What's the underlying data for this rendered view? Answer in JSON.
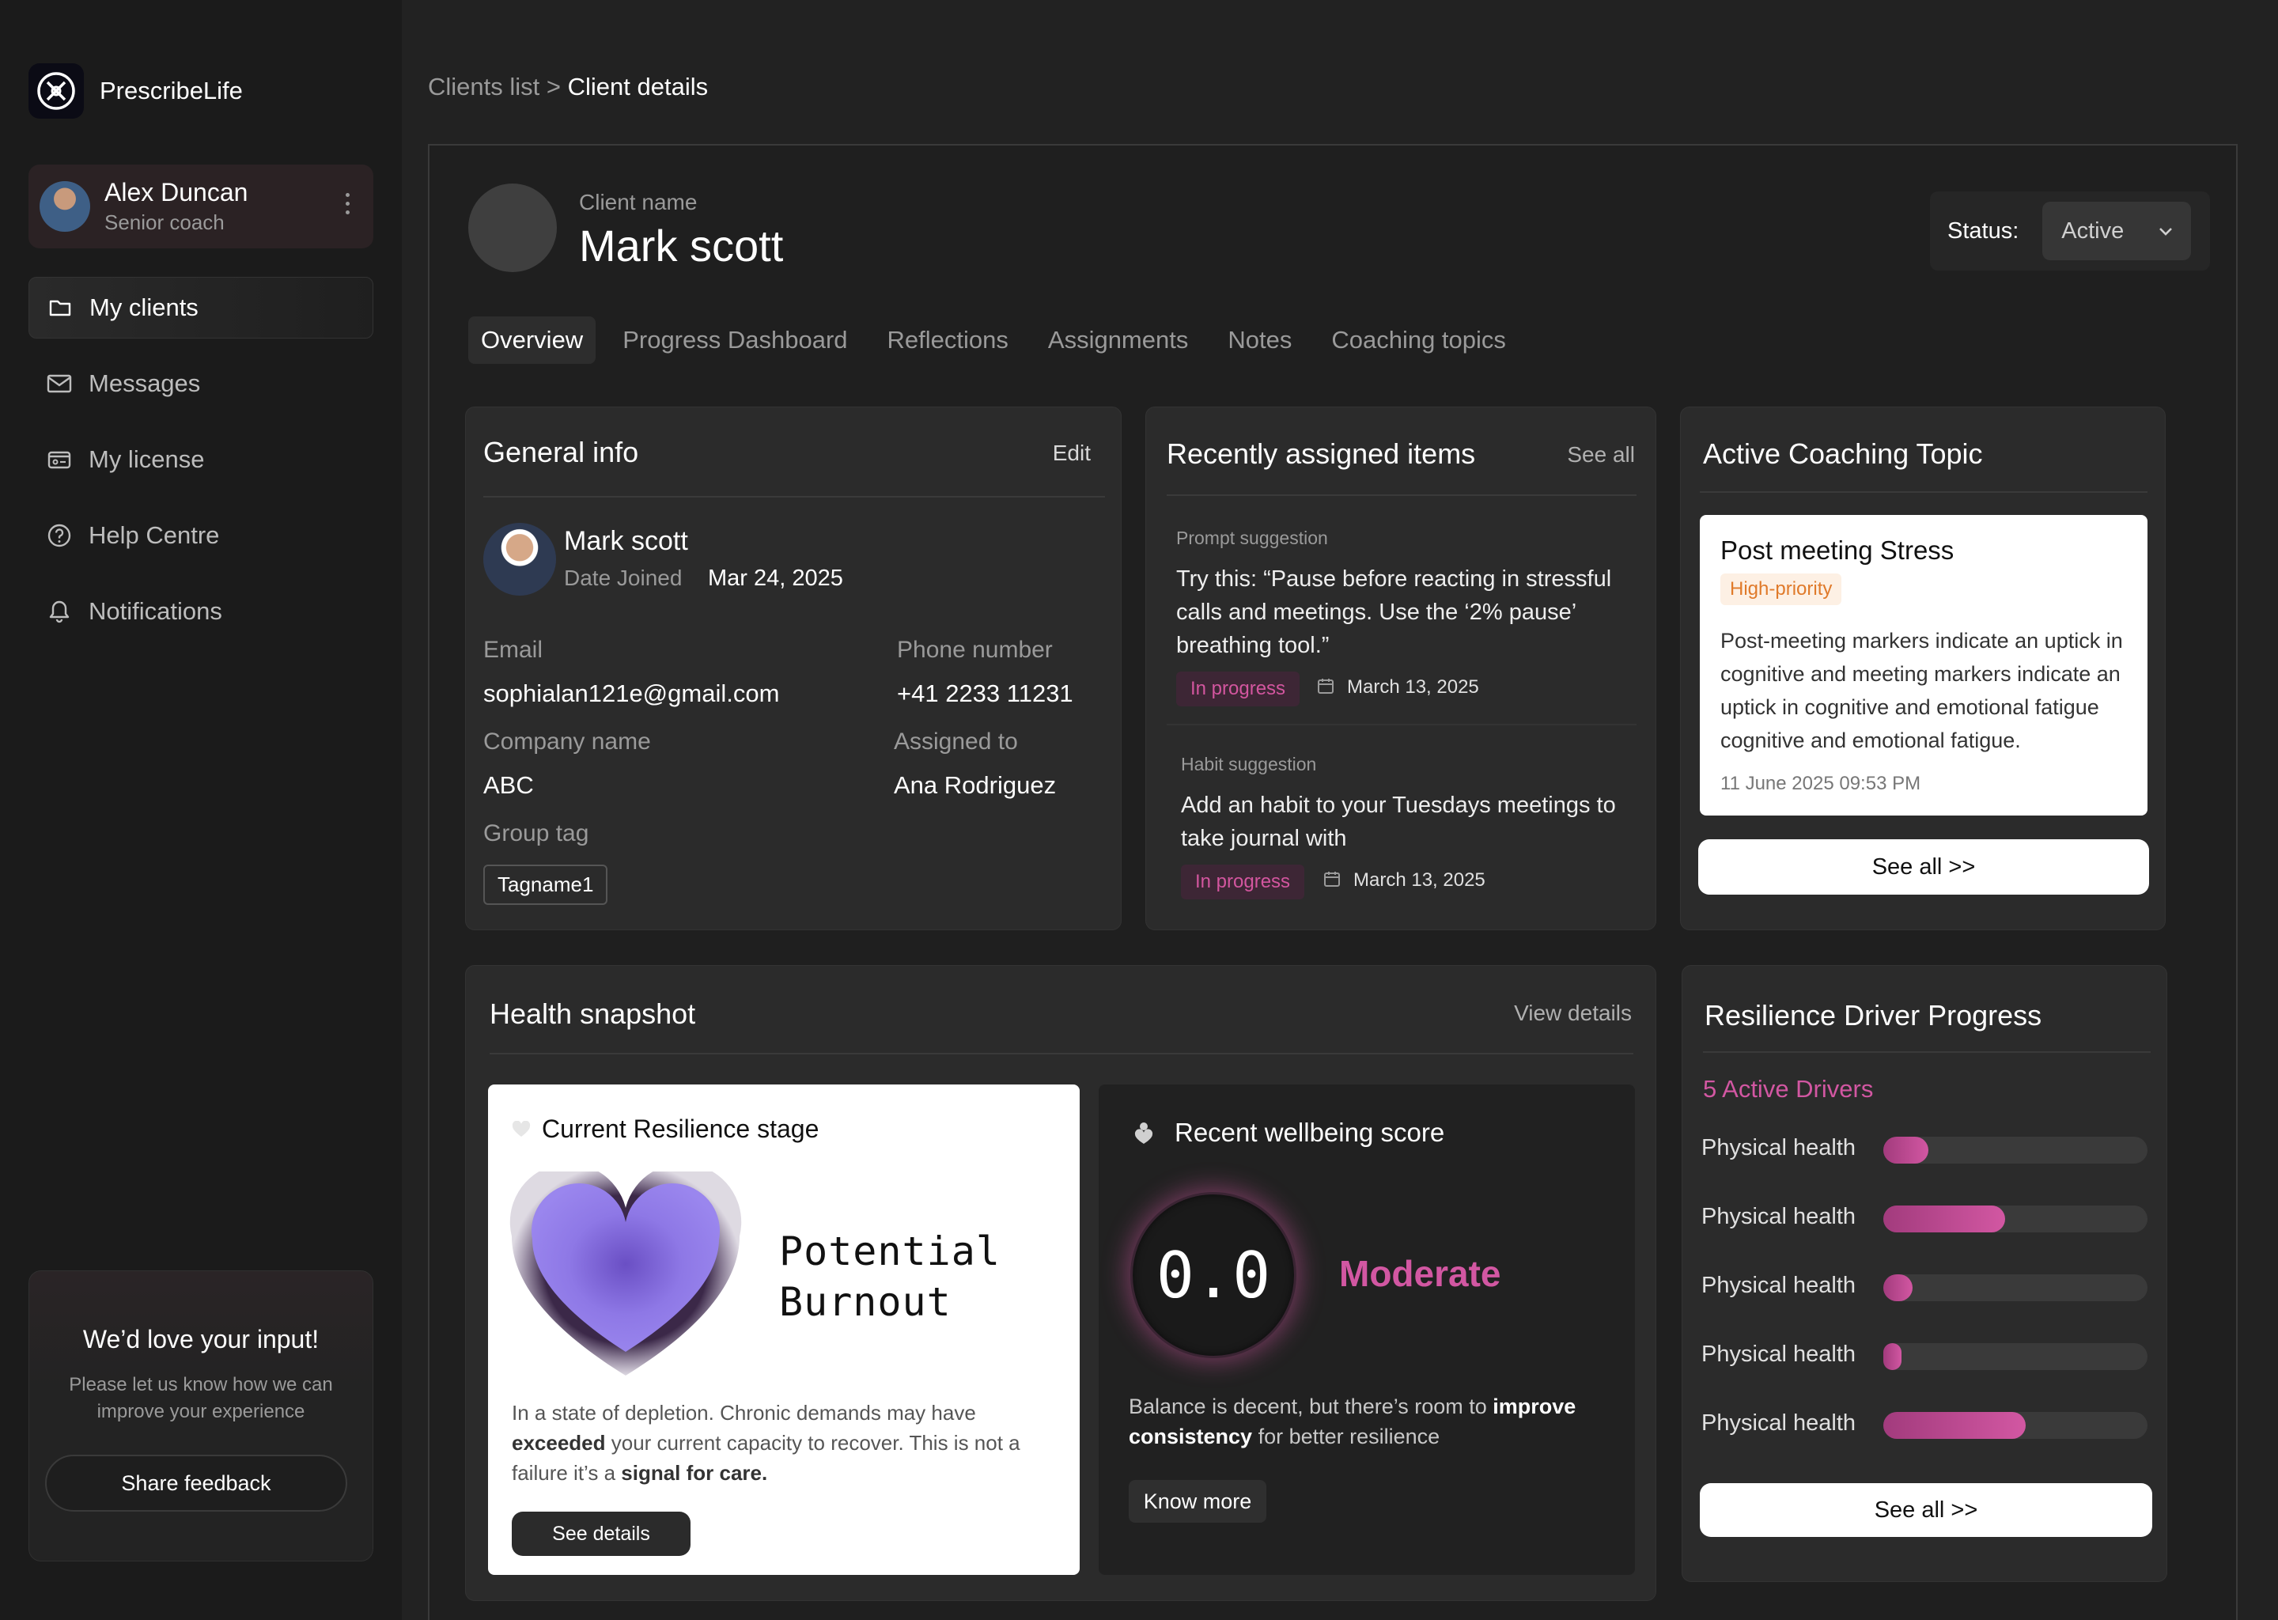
{
  "app": {
    "name": "PrescribeLife"
  },
  "user": {
    "name": "Alex Duncan",
    "role": "Senior coach"
  },
  "nav": [
    {
      "label": "My clients",
      "icon": "folder-icon"
    },
    {
      "label": "Messages",
      "icon": "mail-icon"
    },
    {
      "label": "My license",
      "icon": "license-icon"
    },
    {
      "label": "Help Centre",
      "icon": "help-icon"
    },
    {
      "label": "Notifications",
      "icon": "bell-icon"
    }
  ],
  "feedback": {
    "title": "We’d love your input!",
    "text": "Please let us know how we can improve your experience",
    "button": "Share feedback"
  },
  "breadcrumb": {
    "parent": "Clients list",
    "separator": ">",
    "current": "Client details"
  },
  "client": {
    "label": "Client name",
    "name": "Mark scott"
  },
  "status": {
    "label": "Status:",
    "value": "Active"
  },
  "tabs": [
    "Overview",
    "Progress Dashboard",
    "Reflections",
    "Assignments",
    "Notes",
    "Coaching topics"
  ],
  "general_info": {
    "title": "General info",
    "edit": "Edit",
    "name": "Mark scott",
    "date_joined_label": "Date Joined",
    "date_joined": "Mar 24, 2025",
    "email_label": "Email",
    "email": "sophialan121e@gmail.com",
    "phone_label": "Phone number",
    "phone": "+41 2233 11231",
    "company_label": "Company name",
    "company": "ABC",
    "assigned_label": "Assigned to",
    "assigned": "Ana Rodriguez",
    "group_label": "Group tag",
    "group_tag": "Tagname1"
  },
  "recent_items": {
    "title": "Recently assigned items",
    "see_all": "See all",
    "items": [
      {
        "type": "Prompt suggestion",
        "text": "Try this: “Pause before reacting in stressful calls and meetings. Use the ‘2% pause’ breathing tool.”",
        "status": "In progress",
        "date": "March 13, 2025"
      },
      {
        "type": "Habit suggestion",
        "text": "Add an habit to your Tuesdays meetings to take journal with",
        "status": "In progress",
        "date": "March 13, 2025"
      }
    ]
  },
  "coaching_topic": {
    "title": "Active Coaching Topic",
    "topic": "Post meeting Stress",
    "priority": "High-priority",
    "description": "Post-meeting markers indicate an uptick in cognitive and meeting markers indicate an uptick in cognitive and emotional fatigue cognitive and emotional fatigue.",
    "timestamp": "11 June 2025 09:53 PM",
    "see_all": "See all >>"
  },
  "health": {
    "title": "Health snapshot",
    "view_details": "View details",
    "resilience": {
      "title": "Current Resilience stage",
      "stage_line1": "Potential",
      "stage_line2": "Burnout",
      "text_a": "In a state of depletion. Chronic demands may have ",
      "text_b": "exceeded",
      "text_c": " your current capacity to recover. This is not a failure it’s a ",
      "text_d": "signal for care.",
      "button": "See details"
    },
    "wellbeing": {
      "title": "Recent wellbeing score",
      "score": "0.0",
      "level": "Moderate",
      "text_a": "Balance is decent, but there’s room to ",
      "text_b": "improve consistency",
      "text_c": " for better resilience",
      "button": "Know more"
    }
  },
  "drivers": {
    "title": "Resilience Driver Progress",
    "count_label": "5 Active Drivers",
    "items": [
      {
        "label": "Physical health",
        "progress": 0.17
      },
      {
        "label": "Physical health",
        "progress": 0.46
      },
      {
        "label": "Physical health",
        "progress": 0.11
      },
      {
        "label": "Physical health",
        "progress": 0.07
      },
      {
        "label": "Physical health",
        "progress": 0.54
      }
    ],
    "see_all": "See all >>"
  },
  "colors": {
    "accent": "#d257a2",
    "priority": "#e07a2a",
    "heart": "#8e78e6"
  }
}
